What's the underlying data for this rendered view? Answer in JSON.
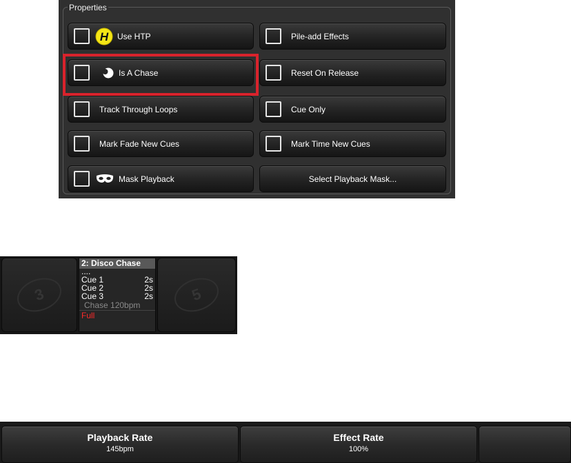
{
  "properties": {
    "legend": "Properties",
    "buttons": {
      "use_htp": "Use HTP",
      "pile_add": "Pile-add Effects",
      "is_chase": "Is A Chase",
      "reset_release": "Reset On Release",
      "track_loops": "Track Through Loops",
      "cue_only": "Cue Only",
      "mark_fade": "Mark Fade New Cues",
      "mark_time": "Mark Time New Cues",
      "mask_playback": "Mask Playback",
      "select_mask": "Select Playback Mask..."
    },
    "htp_icon_letter": "H"
  },
  "playback": {
    "left_slot": "3",
    "right_slot": "5",
    "title": "2: Disco Chase",
    "dots": "....",
    "cues": [
      {
        "name": "Cue 1",
        "time": "2s"
      },
      {
        "name": "Cue 2",
        "time": "2s"
      },
      {
        "name": "Cue 3",
        "time": "2s"
      }
    ],
    "chase": "Chase 120bpm",
    "level": "Full"
  },
  "rates": {
    "playback_rate_label": "Playback Rate",
    "playback_rate_value": "145bpm",
    "effect_rate_label": "Effect Rate",
    "effect_rate_value": "100%"
  },
  "colors": {
    "highlight": "#d9232c",
    "htp_icon": "#f5e616",
    "level_text": "#ff2a2a"
  }
}
